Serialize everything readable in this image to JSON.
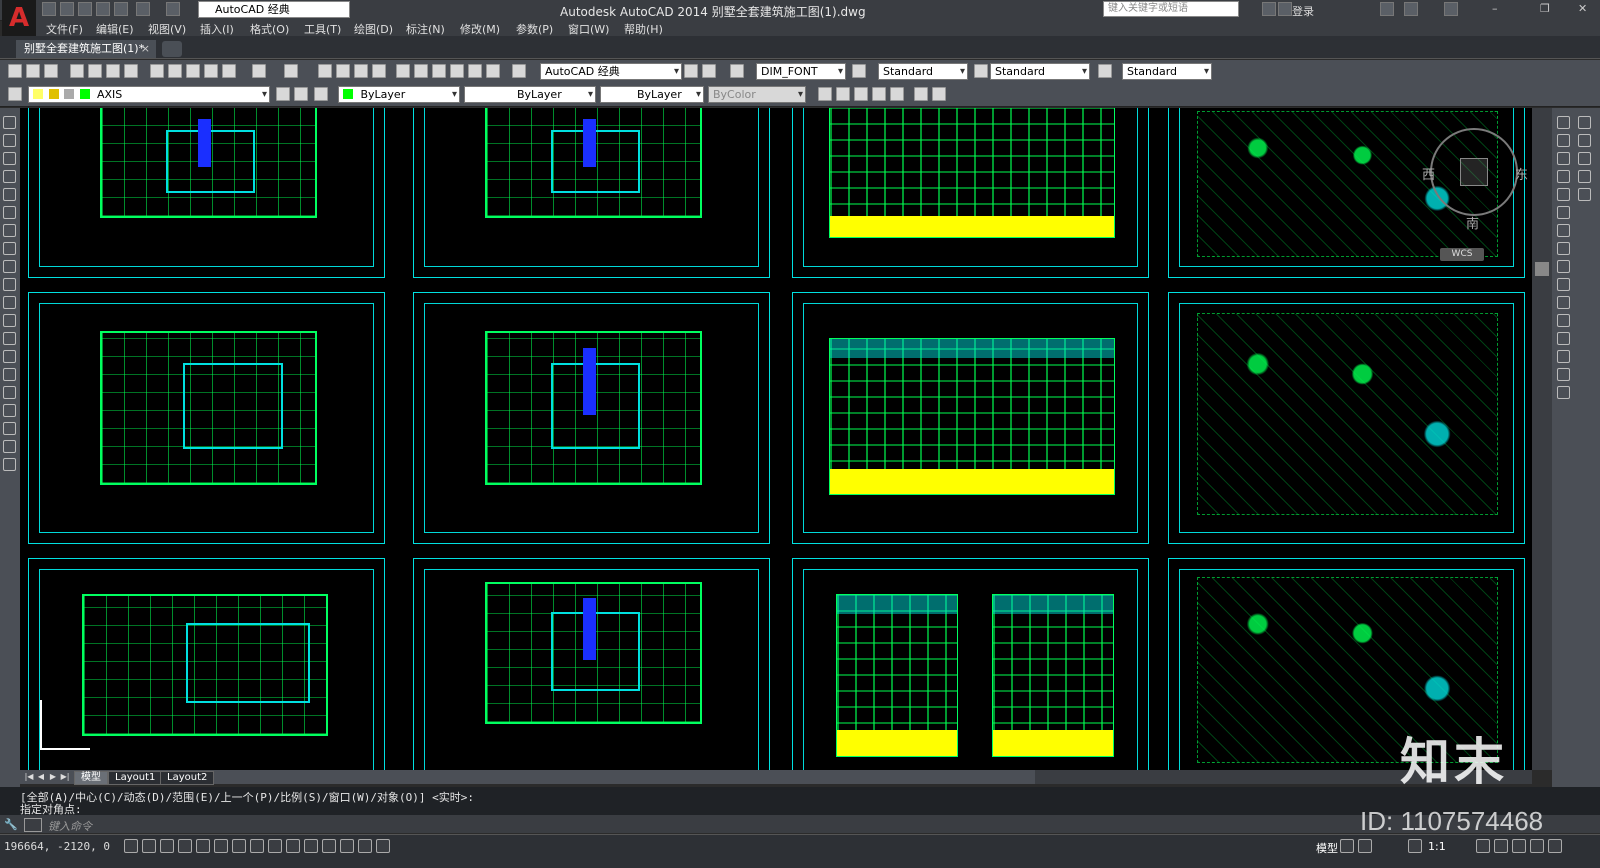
{
  "window": {
    "app_logo": "A",
    "workspace": "AutoCAD 经典",
    "title": "Autodesk AutoCAD 2014    别墅全套建筑施工图(1).dwg",
    "search_placeholder": "键入关键字或短语",
    "login": "登录"
  },
  "menu": [
    "文件(F)",
    "编辑(E)",
    "视图(V)",
    "插入(I)",
    "格式(O)",
    "工具(T)",
    "绘图(D)",
    "标注(N)",
    "修改(M)",
    "参数(P)",
    "窗口(W)",
    "帮助(H)"
  ],
  "document_tab": "别墅全套建筑施工图(1)*",
  "toolbar1": {
    "workspace": "AutoCAD 经典",
    "text_style": "DIM_FONT",
    "dim_style": "Standard",
    "table_style": "Standard",
    "multileader_style": "Standard"
  },
  "toolbar2": {
    "layer": "AXIS",
    "color": "ByLayer",
    "linetype": "ByLayer",
    "lineweight": "ByLayer",
    "plotstyle": "ByColor"
  },
  "viewcube": {
    "west": "西",
    "east": "东",
    "south": "南",
    "wcs": "WCS"
  },
  "layout_tabs": [
    "模型",
    "Layout1",
    "Layout2"
  ],
  "command": {
    "history_1": "[全部(A)/中心(C)/动态(D)/范围(E)/上一个(P)/比例(S)/窗口(W)/对象(O)] <实时>:",
    "history_2": "指定对角点:",
    "input_placeholder": "键入命令"
  },
  "status": {
    "coords": "196664, -2120, 0",
    "model": "模型",
    "scale": "1:1"
  },
  "watermark": {
    "logo": "知末",
    "id": "ID: 1107574468"
  },
  "colors": {
    "drawing_bg": "#000000",
    "frame": "#00e0e0",
    "lines": "#00ff60",
    "highlight": "#ffff00"
  }
}
